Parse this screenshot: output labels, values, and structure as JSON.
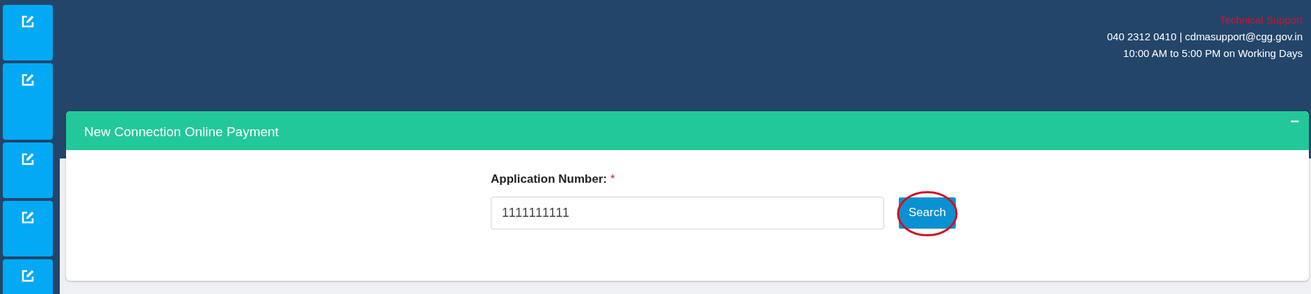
{
  "sidebar": {
    "items": [
      {
        "kind": "edit"
      },
      {
        "kind": "edit"
      },
      {
        "kind": "edit"
      },
      {
        "kind": "edit"
      },
      {
        "kind": "edit"
      }
    ]
  },
  "support": {
    "title": "Technical Support",
    "contact": "040 2312 0410 | cdmasupport@cgg.gov.in",
    "hours": "10:00 AM to 5:00 PM on Working Days"
  },
  "panel": {
    "title": "New Connection Online Payment",
    "collapse_icon": "−",
    "field": {
      "label": "Application Number:",
      "required_mark": "*",
      "value": "1111111111"
    },
    "button": "Search",
    "button_circled": true
  }
}
